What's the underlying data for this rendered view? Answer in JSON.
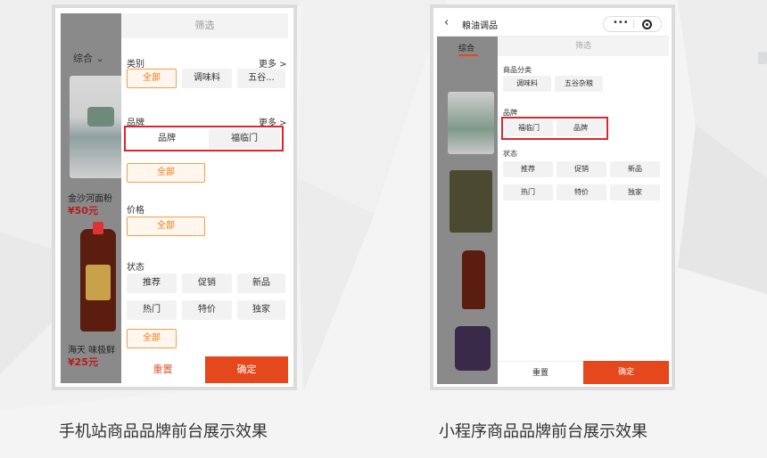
{
  "colors": {
    "accent": "#e5481c",
    "highlight": "#e0242e",
    "selected_chip": "#f07a1a",
    "price": "#b71c1c"
  },
  "left": {
    "caption": "手机站商品品牌前台展示效果",
    "sort_tab": "综合",
    "sort_icon": "chevron-down-icon",
    "products": [
      {
        "name": "金沙河面粉 ",
        "price": "¥50元"
      },
      {
        "name": "海天 味极鲜",
        "price": "¥25元"
      }
    ],
    "drawer": {
      "title": "筛选",
      "category": {
        "label": "类别",
        "more": "更多 >",
        "chips": [
          "全部",
          "调味料",
          "五谷..."
        ]
      },
      "brand": {
        "label": "品牌",
        "more": "更多 >",
        "chips": [
          "品牌",
          "福临门"
        ],
        "all": "全部"
      },
      "price": {
        "label": "价格",
        "all": "全部"
      },
      "status": {
        "label": "状态",
        "chips": [
          "推荐",
          "促销",
          "新品",
          "热门",
          "特价",
          "独家"
        ],
        "all": "全部"
      },
      "reset": "重置",
      "confirm": "确定"
    }
  },
  "right": {
    "caption": "小程序商品品牌前台展示效果",
    "nav_title": "粮油调品",
    "back_icon": "chevron-left-icon",
    "capsule": {
      "dots": "•••",
      "icon": "target-icon"
    },
    "sort_tab": "综合",
    "drawer": {
      "title": "筛选",
      "category": {
        "label": "商品分类",
        "chips": [
          "调味料",
          "五谷杂粮"
        ]
      },
      "brand": {
        "label": "品牌",
        "chips": [
          "福临门",
          "品牌"
        ]
      },
      "status": {
        "label": "状态",
        "chips": [
          "推荐",
          "促销",
          "新品",
          "热门",
          "特价",
          "独家"
        ]
      },
      "reset": "重置",
      "confirm": "确定"
    }
  }
}
